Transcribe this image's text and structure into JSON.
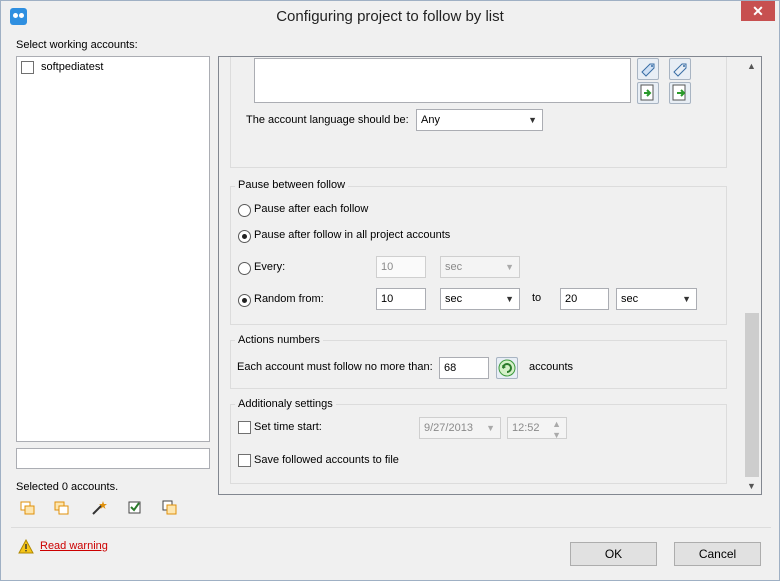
{
  "window": {
    "title": "Configuring project to follow by list",
    "close_symbol": "✕"
  },
  "left": {
    "accounts_label": "Select working accounts:",
    "accounts": [
      {
        "name": "softpediatest",
        "checked": false
      }
    ],
    "filter_value": "",
    "selected_count": "Selected 0 accounts."
  },
  "language": {
    "label": "The account language should be:",
    "value": "Any"
  },
  "pause": {
    "title": "Pause between follow",
    "option_each": "Pause after each follow",
    "option_all": "Pause after follow in all project accounts",
    "every_label": "Every:",
    "every_value": "10",
    "every_unit": "sec",
    "random_label": "Random from:",
    "random_from": "10",
    "random_from_unit": "sec",
    "to_label": "to",
    "random_to": "20",
    "random_to_unit": "sec",
    "selected": "random"
  },
  "actions": {
    "title": "Actions numbers",
    "limit_label": "Each account must follow no more than:",
    "limit_value": "68",
    "limit_unit": "accounts"
  },
  "additional": {
    "title": "Additionaly settings",
    "set_time_label": "Set time start:",
    "date_value": "9/27/2013",
    "time_value": "12:52",
    "save_label": "Save followed accounts to file"
  },
  "footer": {
    "warning_label": "Read warning",
    "ok_label": "OK",
    "cancel_label": "Cancel"
  },
  "colors": {
    "accent": "#2f8fe0",
    "link": "#cc0000",
    "close": "#c75050"
  }
}
